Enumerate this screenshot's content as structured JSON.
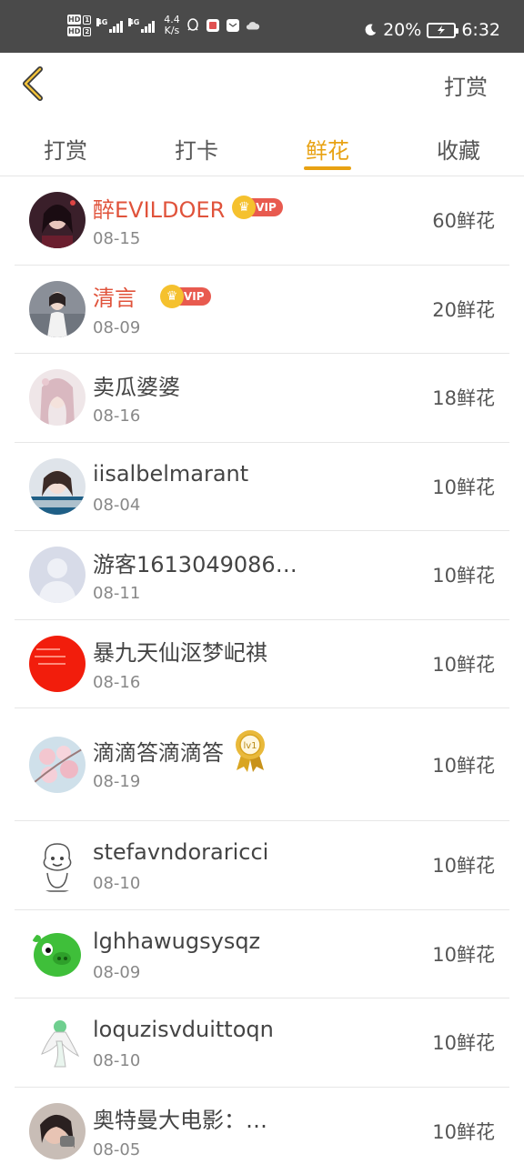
{
  "status_bar": {
    "hd1": "HD",
    "hd1_num": "1",
    "hd2": "HD",
    "hd2_num": "2",
    "net1": "4G",
    "net2": "4G",
    "speed_value": "4.4",
    "speed_unit": "K/s",
    "battery_percent": "20%",
    "time": "6:32"
  },
  "header": {
    "action_label": "打赏"
  },
  "tabs": [
    {
      "label": "打赏",
      "active": false
    },
    {
      "label": "打卡",
      "active": false
    },
    {
      "label": "鲜花",
      "active": true
    },
    {
      "label": "收藏",
      "active": false
    }
  ],
  "vip_label": "VIP",
  "lv_label": "lv1",
  "rows": [
    {
      "name": "醉EVILDOER",
      "date": "08-15",
      "amount": "60鲜花"
    },
    {
      "name": "清言",
      "date": "08-09",
      "amount": "20鲜花"
    },
    {
      "name": "卖瓜婆婆",
      "date": "08-16",
      "amount": "18鲜花"
    },
    {
      "name": "iisalbelmarant",
      "date": "08-04",
      "amount": "10鲜花"
    },
    {
      "name": "游客1613049086…",
      "date": "08-11",
      "amount": "10鲜花"
    },
    {
      "name": "暴九天仙沤梦屺祺",
      "date": "08-16",
      "amount": "10鲜花"
    },
    {
      "name": "滴滴答滴滴答",
      "date": "08-19",
      "amount": "10鲜花"
    },
    {
      "name": "stefavndoraricci",
      "date": "08-10",
      "amount": "10鲜花"
    },
    {
      "name": "lghhawugsysqz",
      "date": "08-09",
      "amount": "10鲜花"
    },
    {
      "name": "loquzisvduittoqn",
      "date": "08-10",
      "amount": "10鲜花"
    },
    {
      "name": "奥特曼大电影：…",
      "date": "08-05",
      "amount": "10鲜花"
    }
  ],
  "colors": {
    "accent": "#e8a213",
    "vip_name": "#e0533b",
    "status_bar": "#4a4a4a"
  }
}
